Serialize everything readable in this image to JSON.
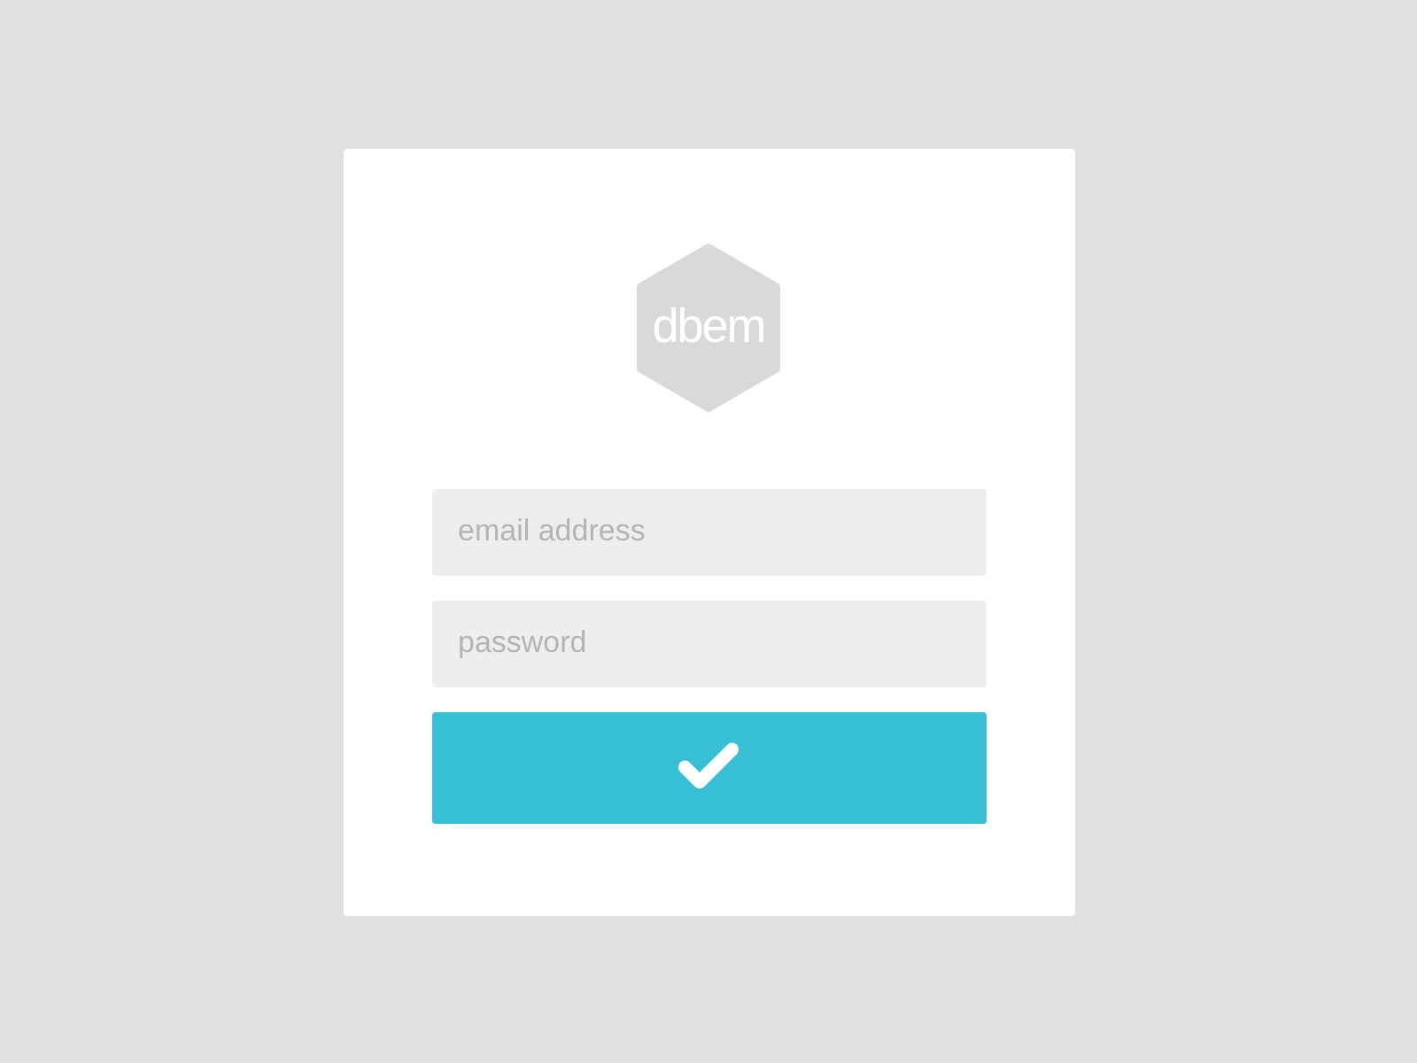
{
  "logo": {
    "text": "dbem"
  },
  "fields": [
    {
      "placeholder": "email address"
    },
    {
      "placeholder": "password"
    }
  ],
  "submit": {
    "kind": "check"
  }
}
